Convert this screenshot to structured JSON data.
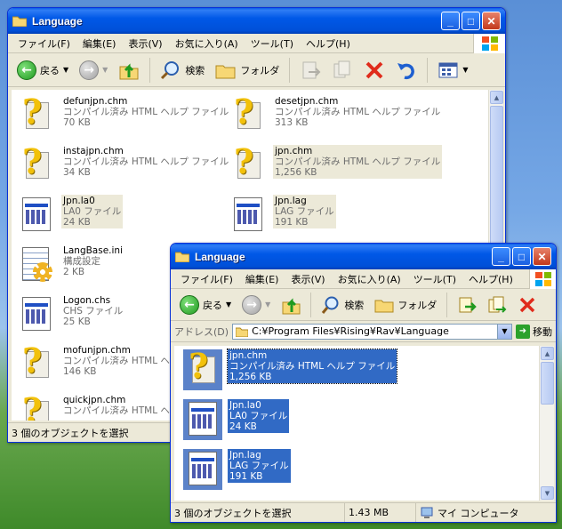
{
  "back_window": {
    "title": "Language",
    "menu": [
      "ファイル(F)",
      "編集(E)",
      "表示(V)",
      "お気に入り(A)",
      "ツール(T)",
      "ヘルプ(H)"
    ],
    "toolbar": {
      "back": "戻る",
      "search": "検索",
      "folders": "フォルダ"
    },
    "files": [
      {
        "name": "defunjpn.chm",
        "type": "コンパイル済み HTML ヘルプ ファイル",
        "size": "70 KB",
        "icon": "help-file-icon"
      },
      {
        "name": "desetjpn.chm",
        "type": "コンパイル済み HTML ヘルプ ファイル",
        "size": "313 KB",
        "icon": "help-file-icon"
      },
      {
        "name": "instajpn.chm",
        "type": "コンパイル済み HTML ヘルプ ファイル",
        "size": "34 KB",
        "icon": "help-file-icon"
      },
      {
        "name": "jpn.chm",
        "type": "コンパイル済み HTML ヘルプ ファイル",
        "size": "1,256 KB",
        "icon": "help-file-icon",
        "selected": true
      },
      {
        "name": "Jpn.la0",
        "type": "LA0 ファイル",
        "size": "24 KB",
        "icon": "generic-file-icon",
        "selected": true
      },
      {
        "name": "Jpn.lag",
        "type": "LAG ファイル",
        "size": "191 KB",
        "icon": "generic-file-icon",
        "selected": true
      },
      {
        "name": "LangBase.ini",
        "type": "構成設定",
        "size": "2 KB",
        "icon": "settings-file-icon"
      },
      {
        "name": "Logon.chs",
        "type": "CHS ファイル",
        "size": "25 KB",
        "icon": "generic-file-icon"
      },
      {
        "name": "mofunjpn.chm",
        "type": "コンパイル済み HTML ヘルプ ファイル",
        "size": "146 KB",
        "icon": "help-file-icon"
      },
      {
        "name": "quickjpn.chm",
        "type": "コンパイル済み HTML ヘルプ ファイル",
        "size": "",
        "icon": "help-file-icon"
      }
    ],
    "status": "3 個のオブジェクトを選択"
  },
  "front_window": {
    "title": "Language",
    "menu": [
      "ファイル(F)",
      "編集(E)",
      "表示(V)",
      "お気に入り(A)",
      "ツール(T)",
      "ヘルプ(H)"
    ],
    "toolbar": {
      "back": "戻る",
      "search": "検索",
      "folders": "フォルダ"
    },
    "address": {
      "label": "アドレス(D)",
      "value": "C:¥Program Files¥Rising¥Rav¥Language",
      "go": "移動"
    },
    "files": [
      {
        "name": "jpn.chm",
        "type": "コンパイル済み HTML ヘルプ ファイル",
        "size": "1,256 KB",
        "icon": "help-file-icon",
        "selected": true
      },
      {
        "name": "Jpn.la0",
        "type": "LA0 ファイル",
        "size": "24 KB",
        "icon": "generic-file-icon",
        "selected": true
      },
      {
        "name": "Jpn.lag",
        "type": "LAG ファイル",
        "size": "191 KB",
        "icon": "generic-file-icon",
        "selected": true
      }
    ],
    "status": {
      "selection": "3 個のオブジェクトを選択",
      "size": "1.43 MB",
      "location": "マイ コンピュータ"
    }
  },
  "colors": {
    "titlebar": "#0058e7",
    "selection": "#316ac5",
    "chrome": "#ece9d8"
  }
}
